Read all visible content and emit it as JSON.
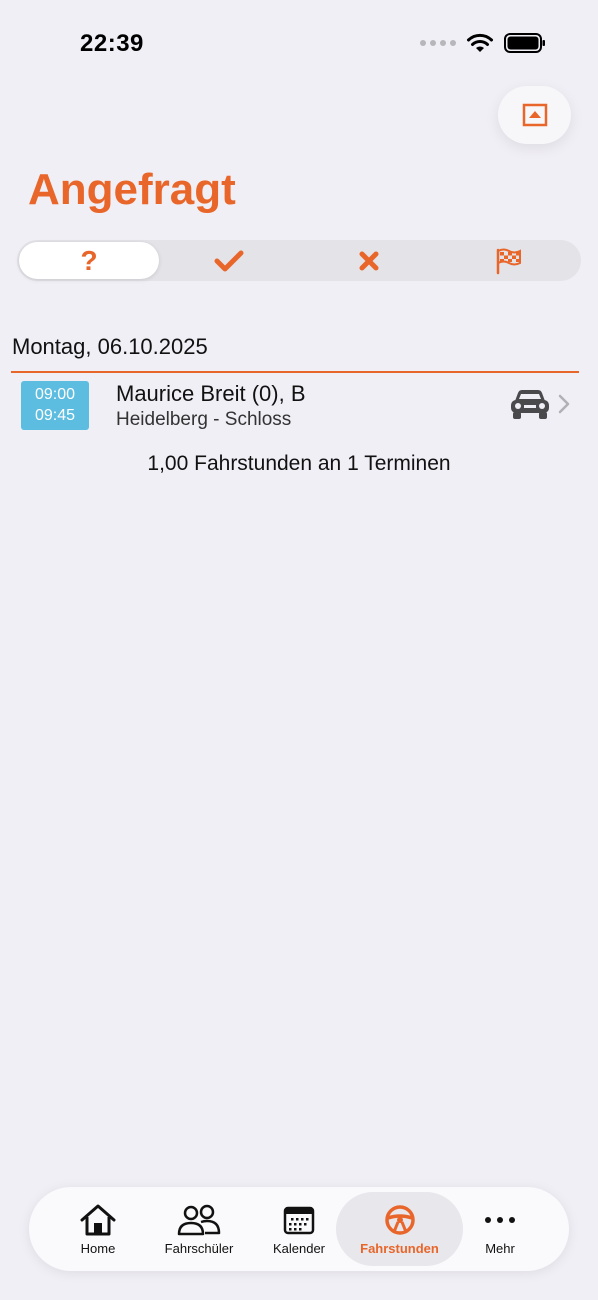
{
  "status_bar": {
    "time": "22:39"
  },
  "page": {
    "title": "Angefragt"
  },
  "segments": [
    {
      "name": "requested",
      "glyph": "?",
      "icon": "question-icon",
      "active": true
    },
    {
      "name": "accepted",
      "glyph": "✔",
      "icon": "check-icon",
      "active": false
    },
    {
      "name": "rejected",
      "glyph": "✖",
      "icon": "x-icon",
      "active": false
    },
    {
      "name": "finished",
      "glyph": "",
      "icon": "checkered-flag-icon",
      "active": false
    }
  ],
  "date_group": {
    "label": "Montag, 06.10.2025"
  },
  "lessons": [
    {
      "start": "09:00",
      "end": "09:45",
      "student": "Maurice Breit (0), B",
      "location": "Heidelberg - Schloss",
      "vehicle_icon": "car-icon"
    }
  ],
  "summary": "1,00 Fahrstunden an 1 Terminen",
  "tabs": [
    {
      "label": "Home",
      "icon": "house-icon",
      "active": false
    },
    {
      "label": "Fahrschüler",
      "icon": "people-icon",
      "active": false
    },
    {
      "label": "Kalender",
      "icon": "calendar-icon",
      "active": false
    },
    {
      "label": "Fahrstunden",
      "icon": "steering-wheel-icon",
      "active": true
    },
    {
      "label": "Mehr",
      "icon": "more-icon",
      "active": false
    }
  ],
  "colors": {
    "accent": "#e9662a",
    "badge": "#5cbde0",
    "background": "#f0eff5"
  }
}
